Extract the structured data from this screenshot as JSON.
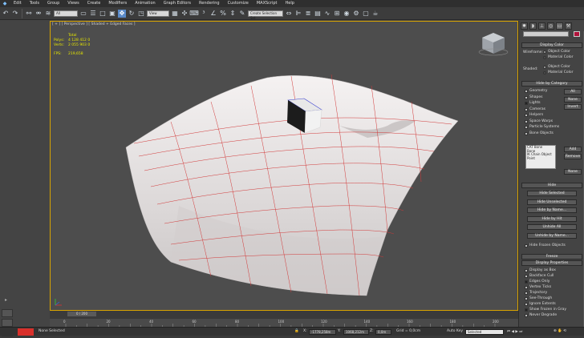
{
  "menu": [
    "Edit",
    "Tools",
    "Group",
    "Views",
    "Create",
    "Modifiers",
    "Animation",
    "Graph Editors",
    "Rendering",
    "Customize",
    "MAXScript",
    "Help"
  ],
  "toolbar": {
    "selection_filter": "All",
    "ref_coord": "View",
    "named_selection": "Create Selection Set"
  },
  "viewport": {
    "label": "[ + ] [ Perspective ] [ Shaded + Edged Faces ]",
    "stats": {
      "header": "Total",
      "polys_label": "Polys:",
      "polys_value": "4 128 412  0",
      "verts_label": "Verts:",
      "verts_value": "2 055 903  0",
      "fps_label": "FPS:",
      "fps_value": "219,658"
    }
  },
  "timeline": {
    "frame_counter": "0 / 200",
    "ticks": [
      "0",
      "20",
      "40",
      "60",
      "80",
      "100",
      "120",
      "140",
      "160",
      "180",
      "200"
    ]
  },
  "status": {
    "selection": "None Selected",
    "x_label": "X:",
    "x_value": "-1778,258m",
    "y_label": "Y:",
    "y_value": "1068,212m",
    "z_label": "Z:",
    "z_value": "0,0m",
    "grid": "Grid = 0,0cm",
    "autokey": "Auto Key",
    "selected": "Selected"
  },
  "panel": {
    "display_color": {
      "title": "Display Color",
      "wireframe_label": "Wireframe:",
      "shaded_label": "Shaded:",
      "object_color": "Object Color",
      "material_color": "Material Color"
    },
    "hide_by_category": {
      "title": "Hide by Category",
      "items": [
        "Geometry",
        "Shapes",
        "Lights",
        "Cameras",
        "Helpers",
        "Space Warps",
        "Particle Systems",
        "Bone Objects"
      ],
      "all_btn": "All",
      "none_btn": "None",
      "invert_btn": "Invert",
      "list": [
        "CAT Bone",
        "Bone",
        "IK Chain Object",
        "Point"
      ],
      "add_btn": "Add",
      "remove_btn": "Remove",
      "none2_btn": "None"
    },
    "hide": {
      "title": "Hide",
      "buttons": [
        "Hide Selected",
        "Hide Unselected",
        "Hide by Name...",
        "Hide by Hit",
        "Unhide All",
        "Unhide by Name..."
      ],
      "hide_frozen": "Hide Frozen Objects"
    },
    "freeze": {
      "title": "Freeze"
    },
    "display_properties": {
      "title": "Display Properties",
      "items": [
        "Display as Box",
        "Backface Cull",
        "Edges Only",
        "Vertex Ticks",
        "Trajectory",
        "See-Through",
        "Ignore Extents",
        "Show Frozen in Gray",
        "Never Degrade"
      ]
    }
  }
}
